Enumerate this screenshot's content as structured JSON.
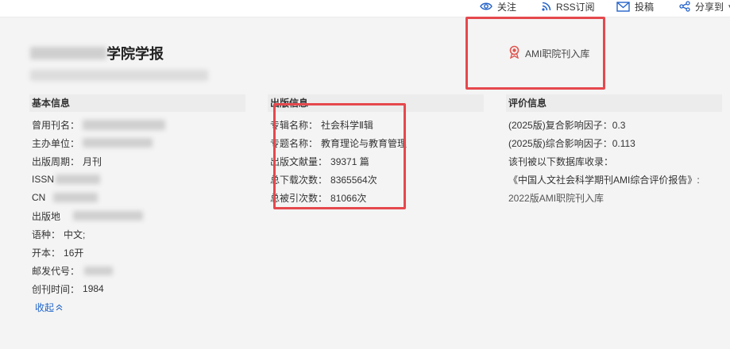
{
  "topbar": {
    "follow_label": "关注",
    "rss_label": "RSS订阅",
    "submit_label": "投稿",
    "share_label": "分享到"
  },
  "journal": {
    "title_suffix": "学院学报"
  },
  "ami_badge": {
    "label": "AMI职院刊入库"
  },
  "basic_info": {
    "heading": "基本信息",
    "former_name_label": "曾用刊名：",
    "sponsor_label": "主办单位：",
    "frequency_label": "出版周期：",
    "frequency_value": "月刊",
    "issn_label": "ISSN",
    "cn_label": "CN",
    "place_label": "出版地",
    "language_label": "语种：",
    "language_value": "中文;",
    "format_label": "开本：",
    "format_value": "16开",
    "postal_label": "邮发代号：",
    "founded_label": "创刊时间：",
    "founded_value": "1984",
    "collapse_label": "收起"
  },
  "publish_info": {
    "heading": "出版信息",
    "series_label": "专辑名称：",
    "series_value": "社会科学Ⅱ辑",
    "topic_label": "专题名称：",
    "topic_value": "教育理论与教育管理",
    "docs_label": "出版文献量：",
    "docs_value": "39371 篇",
    "downloads_label": "总下载次数：",
    "downloads_value": "8365564次",
    "citations_label": "总被引次数：",
    "citations_value": "81066次"
  },
  "eval_info": {
    "heading": "评价信息",
    "composite_if": "(2025版)复合影响因子：0.3",
    "comprehensive_if": "(2025版)综合影响因子：0.113",
    "indexed_by": "该刊被以下数据库收录：",
    "report_name": "《中国人文社会科学期刊AMI综合评价报告》:",
    "report_entry": "2022版AMI职院刊入库"
  },
  "colors": {
    "highlight_box": "#e5484d",
    "link": "#1d63c7",
    "icon_blue": "#2563c9",
    "badge_red": "#e0554f"
  }
}
